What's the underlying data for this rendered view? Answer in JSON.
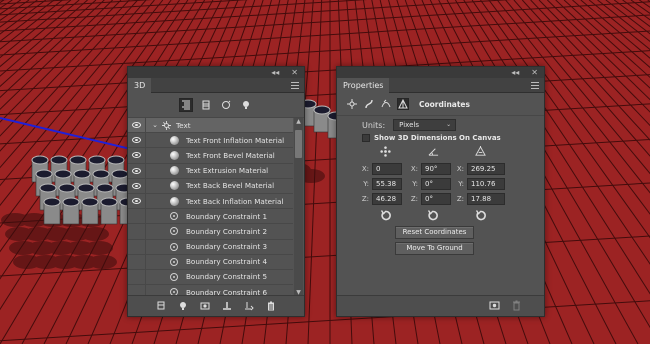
{
  "panel_3d": {
    "tab_label": "3D",
    "collapse_glyph": "◂◂",
    "close_glyph": "✕",
    "filter_buttons": [
      "whole-scene-icon",
      "meshes-icon",
      "materials-icon",
      "lights-icon"
    ],
    "parent_layer": {
      "label": "Text",
      "expanded": true
    },
    "layers": [
      {
        "label": "Text Front Inflation Material",
        "type": "material",
        "visible": true
      },
      {
        "label": "Text Front Bevel Material",
        "type": "material",
        "visible": true
      },
      {
        "label": "Text Extrusion Material",
        "type": "material",
        "visible": true
      },
      {
        "label": "Text Back Bevel Material",
        "type": "material",
        "visible": true
      },
      {
        "label": "Text Back Inflation Material",
        "type": "material",
        "visible": true
      },
      {
        "label": "Boundary Constraint 1",
        "type": "constraint",
        "visible": false
      },
      {
        "label": "Boundary Constraint 2",
        "type": "constraint",
        "visible": false
      },
      {
        "label": "Boundary Constraint 3",
        "type": "constraint",
        "visible": false
      },
      {
        "label": "Boundary Constraint 4",
        "type": "constraint",
        "visible": false
      },
      {
        "label": "Boundary Constraint 5",
        "type": "constraint",
        "visible": false
      },
      {
        "label": "Boundary Constraint 6",
        "type": "constraint",
        "visible": false
      }
    ]
  },
  "properties": {
    "tab_label": "Properties",
    "collapse_glyph": "◂◂",
    "close_glyph": "✕",
    "section_title": "Coordinates",
    "units_label": "Units:",
    "units_value": "Pixels",
    "show_dimensions_label": "Show 3D Dimensions On Canvas",
    "show_dimensions_checked": false,
    "position": {
      "x": "0",
      "y": "55.38",
      "z": "46.28"
    },
    "rotation": {
      "x": "90°",
      "y": "0°",
      "z": "0°"
    },
    "scale": {
      "x": "269.25",
      "y": "110.76",
      "z": "17.88"
    },
    "reset_coordinates_label": "Reset Coordinates",
    "move_to_ground_label": "Move To Ground"
  },
  "colors": {
    "background": "#9c2323",
    "grid_line": "#3a0a0a",
    "panel": "#535353"
  }
}
